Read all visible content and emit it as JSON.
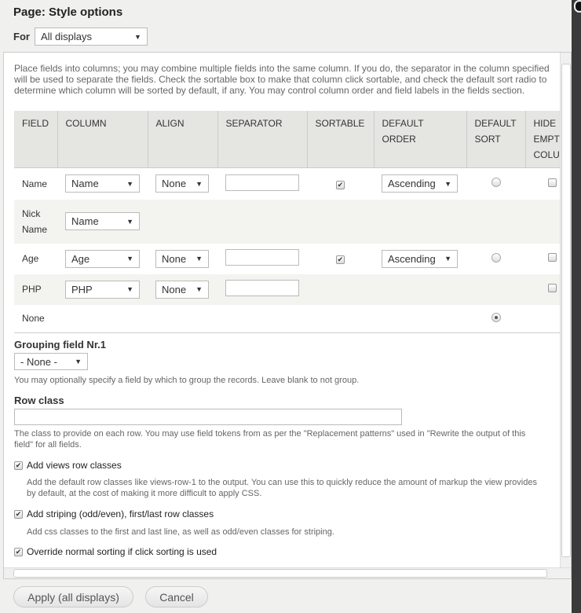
{
  "header": {
    "title": "Page: Style options",
    "for_label": "For",
    "for_value": "All displays"
  },
  "description": "Place fields into columns; you may combine multiple fields into the same column. If you do, the separator in the column specified will be used to separate the fields. Check the sortable box to make that column click sortable, and check the default sort radio to determine which column will be sorted by default, if any. You may control column order and field labels in the fields section.",
  "table": {
    "headers": [
      "FIELD",
      "COLUMN",
      "ALIGN",
      "SEPARATOR",
      "SORTABLE",
      "DEFAULT ORDER",
      "DEFAULT SORT",
      "HIDE EMPTY COLUMN"
    ],
    "rows": [
      {
        "field": "Name",
        "column": "Name",
        "align": "None",
        "separator": "",
        "sortable": true,
        "order": "Ascending",
        "default_sort": false,
        "hide_empty": false
      },
      {
        "field": "Nick Name",
        "column": "Name"
      },
      {
        "field": "Age",
        "column": "Age",
        "align": "None",
        "separator": "",
        "sortable": true,
        "order": "Ascending",
        "default_sort": false,
        "hide_empty": false
      },
      {
        "field": "PHP",
        "column": "PHP",
        "align": "None",
        "separator": "",
        "hide_empty": false
      },
      {
        "field": "None",
        "default_sort": true
      }
    ]
  },
  "grouping": {
    "label": "Grouping field Nr.1",
    "value": "- None -",
    "help": "You may optionally specify a field by which to group the records. Leave blank to not group."
  },
  "row_class": {
    "label": "Row class",
    "value": "",
    "help": "The class to provide on each row. You may use field tokens from as per the \"Replacement patterns\" used in \"Rewrite the output of this field\" for all fields."
  },
  "options": [
    {
      "label": "Add views row classes",
      "checked": true,
      "help": "Add the default row classes like views-row-1 to the output. You can use this to quickly reduce the amount of markup the view provides by default, at the cost of making it more difficult to apply CSS."
    },
    {
      "label": "Add striping (odd/even), first/last row classes",
      "checked": true,
      "help": "Add css classes to the first and last line, as well as odd/even classes for striping."
    },
    {
      "label": "Override normal sorting if click sorting is used",
      "checked": true
    }
  ],
  "buttons": {
    "apply": "Apply (all displays)",
    "cancel": "Cancel"
  }
}
